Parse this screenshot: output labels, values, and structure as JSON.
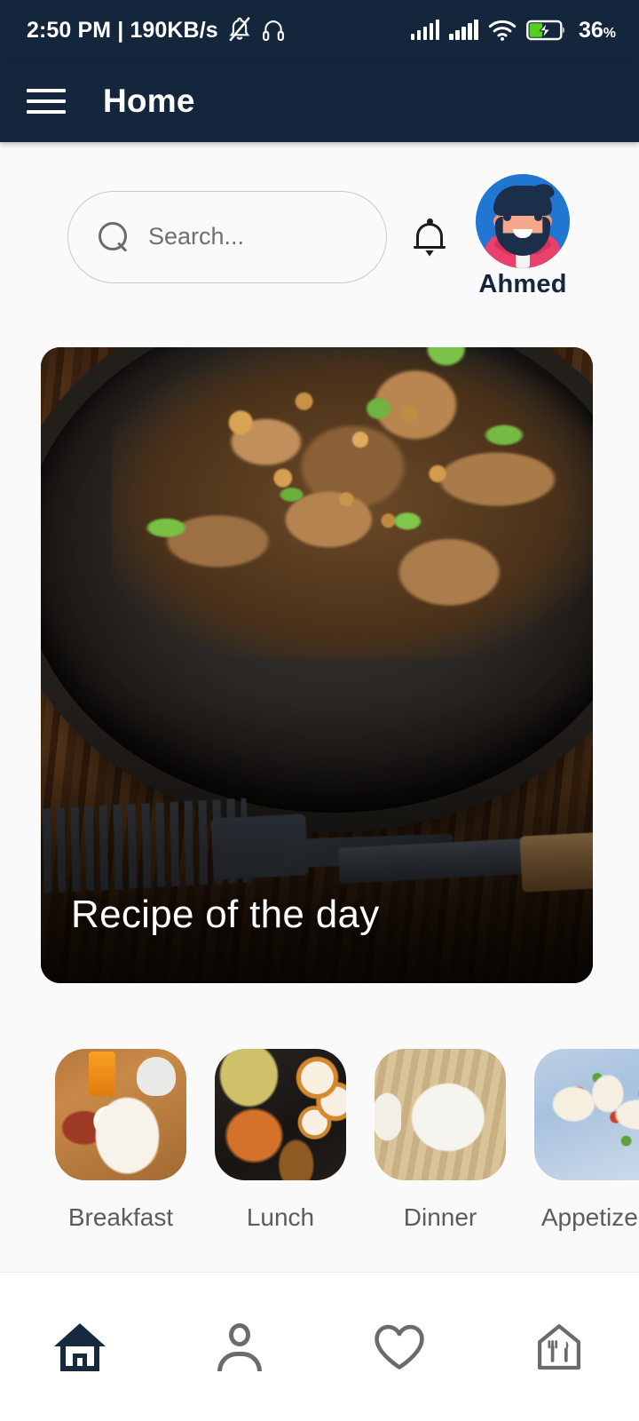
{
  "statusbar": {
    "time": "2:50 PM",
    "separator": "|",
    "network_speed": "190KB/s",
    "mute_icon": "bell-mute-icon",
    "headphones_icon": "headphones-icon",
    "signal1_icon": "signal-bars-icon",
    "signal2_icon": "signal-bars-icon",
    "wifi_icon": "wifi-icon",
    "battery_icon": "battery-charging-icon",
    "battery_percent": "36",
    "battery_percent_sign": "%",
    "bar_color": "#14263c"
  },
  "appbar": {
    "menu_icon": "hamburger-menu-icon",
    "title": "Home",
    "background": "#14263c",
    "text_color": "#ffffff"
  },
  "search": {
    "icon": "search-icon",
    "placeholder": "Search...",
    "value": ""
  },
  "notifications": {
    "icon": "bell-icon"
  },
  "profile": {
    "avatar_icon": "user-avatar-bearded-man",
    "name": "Ahmed",
    "avatar_background": "#2176d2",
    "name_color": "#14263c"
  },
  "hero": {
    "title": "Recipe of the day",
    "image_alt": "fried-meat-in-cast-iron-skillet",
    "title_color": "#ffffff"
  },
  "categories": [
    {
      "label": "Breakfast",
      "thumb": "breakfast-thumb"
    },
    {
      "label": "Lunch",
      "thumb": "lunch-thumb"
    },
    {
      "label": "Dinner",
      "thumb": "dinner-thumb"
    },
    {
      "label": "Appetizers",
      "thumb": "appetizers-thumb"
    }
  ],
  "bottom_nav": {
    "active_color": "#17293f",
    "inactive_color": "#6b6b6b",
    "items": [
      {
        "name": "home",
        "icon": "home-icon",
        "active": true
      },
      {
        "name": "profile",
        "icon": "person-icon",
        "active": false
      },
      {
        "name": "favorites",
        "icon": "heart-icon",
        "active": false
      },
      {
        "name": "restaurants",
        "icon": "restaurant-house-icon",
        "active": false
      }
    ]
  },
  "theme": {
    "content_background": "#fafafa",
    "nav_background": "#ffffff"
  }
}
